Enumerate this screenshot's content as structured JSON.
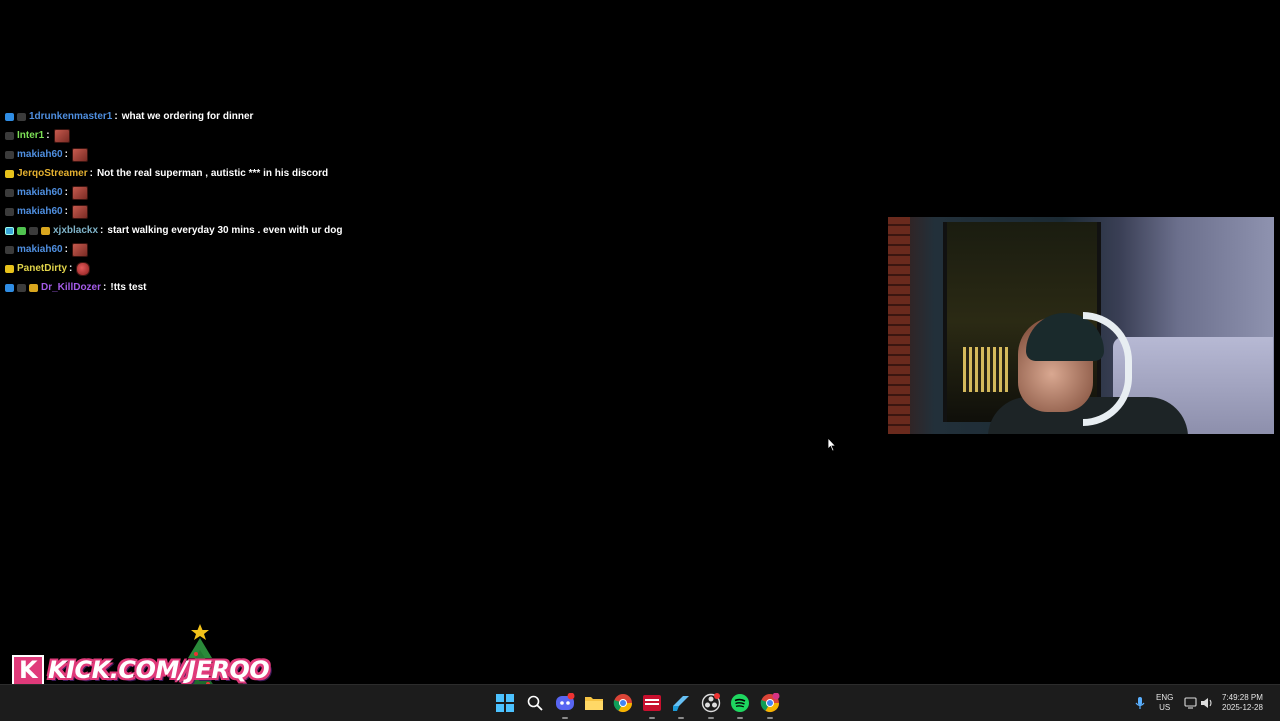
{
  "chat": {
    "messages": [
      {
        "username": "1drunkenmaster1",
        "user_color": "#4f8fe0",
        "message": "what we ordering for dinner",
        "badges": [
          "b-blue",
          "b-grey"
        ],
        "emote": false
      },
      {
        "username": "Inter1",
        "user_color": "#7ddf56",
        "message": "",
        "badges": [
          "b-grey"
        ],
        "emote": true
      },
      {
        "username": "makiah60",
        "user_color": "#4f8fe0",
        "message": "",
        "badges": [
          "b-grey"
        ],
        "emote": true
      },
      {
        "username": "JerqoStreamer",
        "user_color": "#e3b030",
        "message": "Not the real superman , autistic *** in his discord",
        "badges": [
          "b-yellow"
        ],
        "emote": false
      },
      {
        "username": "makiah60",
        "user_color": "#4f8fe0",
        "message": "",
        "badges": [
          "b-grey"
        ],
        "emote": true
      },
      {
        "username": "makiah60",
        "user_color": "#4f8fe0",
        "message": "",
        "badges": [
          "b-grey"
        ],
        "emote": true
      },
      {
        "username": "xjxblackx",
        "user_color": "#7fb3c8",
        "message": "start walking everyday 30 mins . even with ur dog",
        "badges": [
          "b-sub",
          "b-green",
          "b-grey",
          "b-gold"
        ],
        "emote": false
      },
      {
        "username": "makiah60",
        "user_color": "#4f8fe0",
        "message": "",
        "badges": [
          "b-grey"
        ],
        "emote": true
      },
      {
        "username": "PanetDirty",
        "user_color": "#e0d34a",
        "message": "",
        "badges": [
          "b-yellow"
        ],
        "emote": true,
        "emote_round": true
      },
      {
        "username": "Dr_KillDozer",
        "user_color": "#a35be6",
        "message": "!tts test",
        "badges": [
          "b-blue",
          "b-grey",
          "b-gold"
        ],
        "emote": false
      }
    ]
  },
  "overlay": {
    "kick_url": "KICK.COM/JERQO"
  },
  "taskbar": {
    "icons": [
      "windows-start-icon",
      "search-icon",
      "discord-icon",
      "file-explorer-icon",
      "chrome-icon",
      "streaming-app-icon",
      "steam-icon",
      "obs-icon",
      "spotify-icon",
      "chrome-profile-icon"
    ],
    "language": "ENG",
    "region": "US",
    "time": "7:49:28 PM",
    "date": "2025-12-28"
  }
}
